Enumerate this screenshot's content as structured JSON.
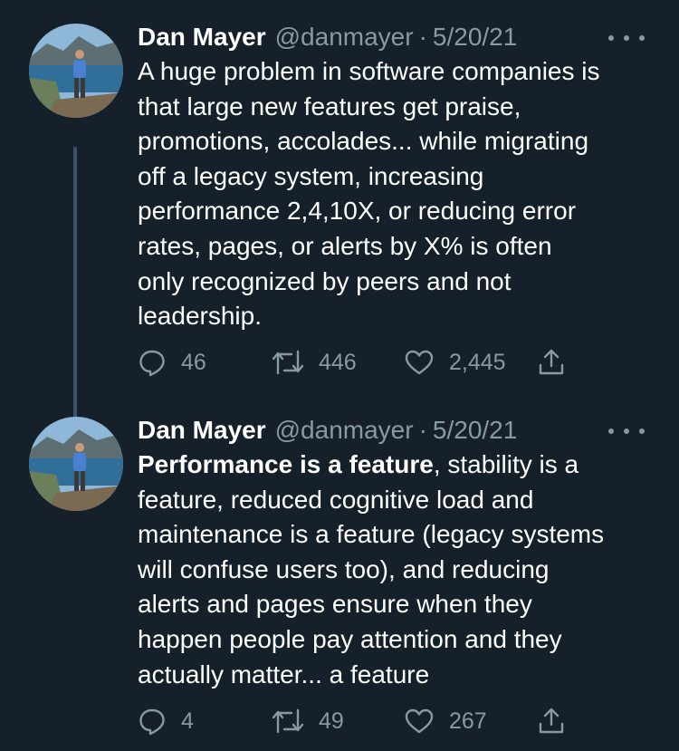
{
  "tweets": [
    {
      "author_name": "Dan Mayer",
      "handle": "@danmayer",
      "separator": "·",
      "date": "5/20/21",
      "text": "A huge problem in software companies is\nthat large new features get praise,\npromotions, accolades... while migrating\noff a legacy system, increasing\nperformance 2,4,10X, or reducing error\nrates, pages, or alerts by X% is often\nonly recognized by peers and not\nleadership.",
      "replies": "46",
      "retweets": "446",
      "likes": "2,445"
    },
    {
      "author_name": "Dan Mayer",
      "handle": "@danmayer",
      "separator": "·",
      "date": "5/20/21",
      "text_bold": "Performance is a feature",
      "text": ", stability is a\nfeature, reduced cognitive load and\nmaintenance is a feature (legacy systems\nwill confuse users too), and reducing\nalerts and pages ensure when they\nhappen people pay attention and they\nactually matter... a feature",
      "replies": "4",
      "retweets": "49",
      "likes": "267"
    }
  ],
  "icons": {
    "reply": "reply-icon",
    "retweet": "retweet-icon",
    "like": "heart-icon",
    "share": "share-icon",
    "more": "more-options-icon"
  },
  "colors": {
    "background": "#15202b",
    "text": "#ffffff",
    "secondary": "#8899a6",
    "thread_line": "#3d5466"
  }
}
